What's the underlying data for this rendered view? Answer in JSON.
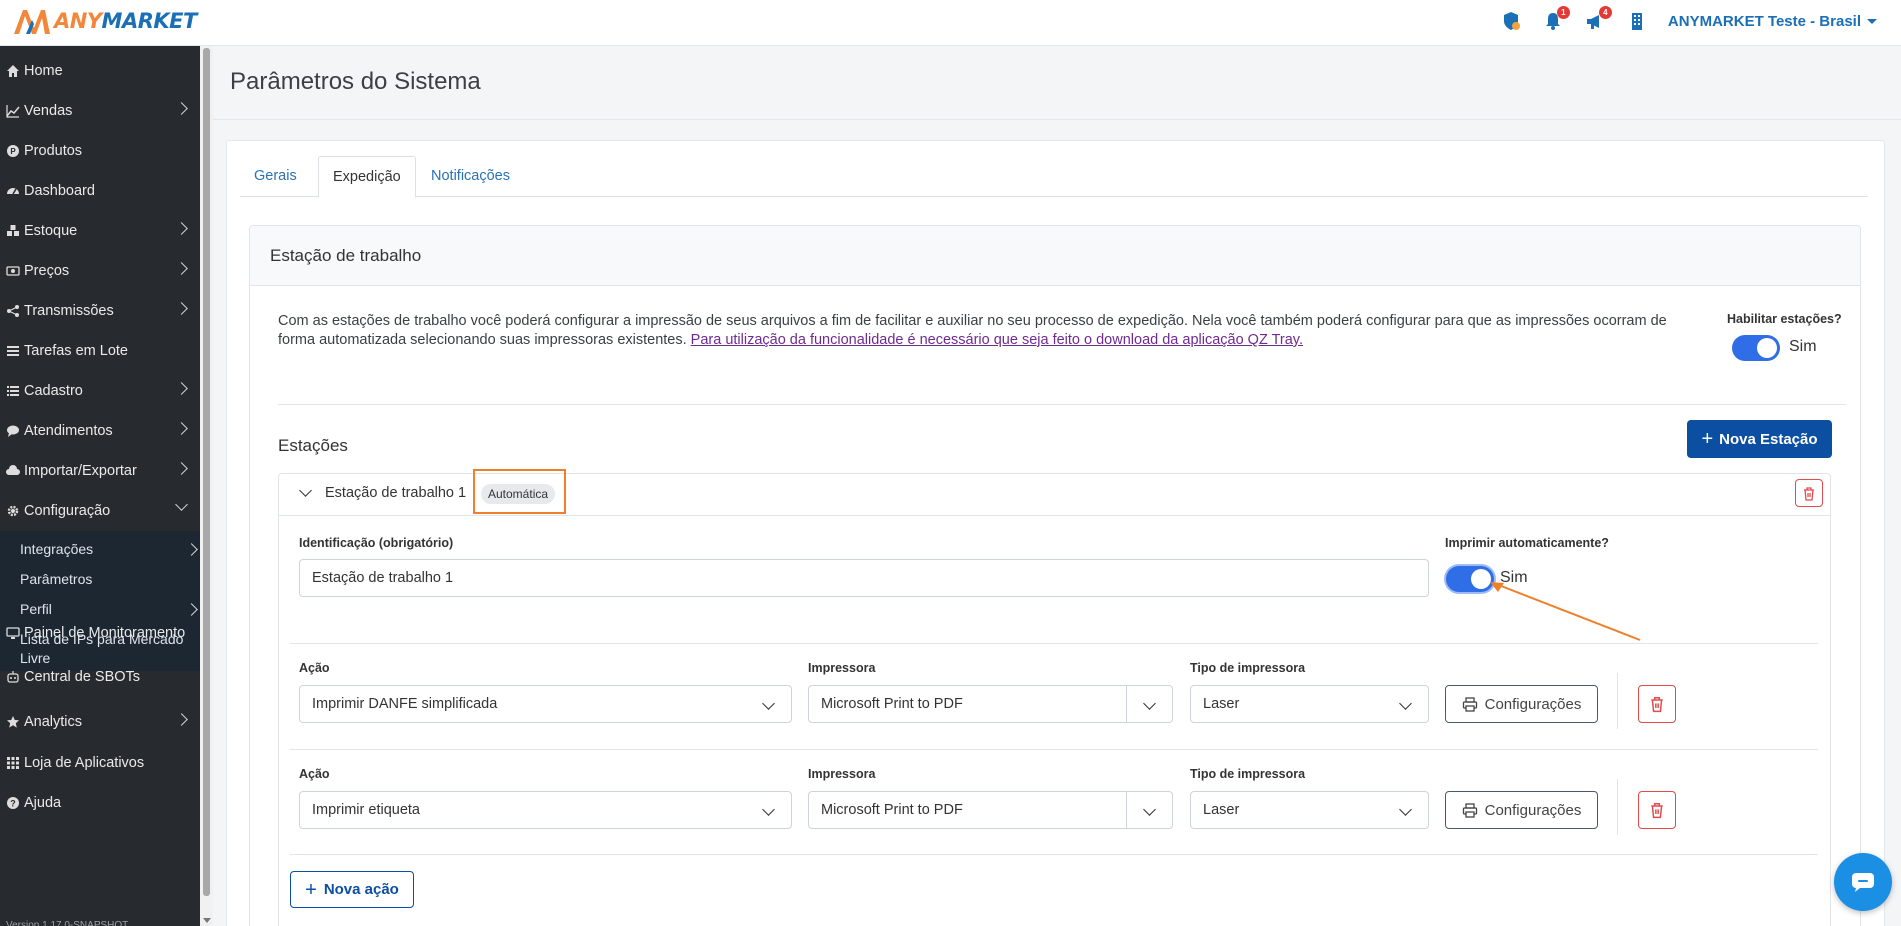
{
  "header": {
    "logo_text_part1": "ANY",
    "logo_text_part2": "MARKET",
    "notifications_count": "1",
    "announcements_count": "4",
    "account_name": "ANYMARKET Teste - Brasil"
  },
  "sidebar": {
    "items": [
      {
        "label": "Home",
        "icon": "home-icon",
        "has_children": false
      },
      {
        "label": "Vendas",
        "icon": "chart-line-icon",
        "has_children": true
      },
      {
        "label": "Produtos",
        "icon": "product-icon",
        "has_children": false
      },
      {
        "label": "Dashboard",
        "icon": "dashboard-icon",
        "has_children": false
      },
      {
        "label": "Estoque",
        "icon": "boxes-icon",
        "has_children": true
      },
      {
        "label": "Preços",
        "icon": "money-icon",
        "has_children": true
      },
      {
        "label": "Transmissões",
        "icon": "share-icon",
        "has_children": true
      },
      {
        "label": "Tarefas em Lote",
        "icon": "tasks-icon",
        "has_children": false
      },
      {
        "label": "Cadastro",
        "icon": "list-icon",
        "has_children": true
      },
      {
        "label": "Atendimentos",
        "icon": "chat-bubble-icon",
        "has_children": true
      },
      {
        "label": "Importar/Exportar",
        "icon": "cloud-icon",
        "has_children": true
      },
      {
        "label": "Configuração",
        "icon": "gear-icon",
        "has_children": true,
        "expanded": true
      }
    ],
    "sub_items": [
      {
        "label": "Integrações",
        "has_children": true
      },
      {
        "label": "Parâmetros",
        "has_children": false
      },
      {
        "label": "Perfil",
        "has_children": true
      },
      {
        "label": "Lista de IPs para Mercado Livre",
        "has_children": false
      }
    ],
    "items_after": [
      {
        "label": "Painel de Monitoramento",
        "icon": "monitor-icon",
        "has_children": false
      },
      {
        "label": "Central de SBOTs",
        "icon": "robot-icon",
        "has_children": false
      },
      {
        "label": "Analytics",
        "icon": "star-icon",
        "has_children": true
      },
      {
        "label": "Loja de Aplicativos",
        "icon": "grid-icon",
        "has_children": false
      },
      {
        "label": "Ajuda",
        "icon": "help-icon",
        "has_children": false
      }
    ],
    "version": "Version 1.17.0-SNAPSHOT"
  },
  "page": {
    "title": "Parâmetros do Sistema",
    "tabs": [
      {
        "label": "Gerais",
        "active": false
      },
      {
        "label": "Expedição",
        "active": true
      },
      {
        "label": "Notificações",
        "active": false
      }
    ]
  },
  "workstation": {
    "card_title": "Estação de trabalho",
    "description": "Com as estações de trabalho você poderá configurar a impressão de seus arquivos a fim de facilitar e auxiliar no seu processo de expedição. Nela você também poderá configurar para que as impressões ocorram de forma automatizada selecionando suas impressoras existentes. ",
    "description_link": "Para utilização da funcionalidade é necessário que seja feito o download da aplicação QZ Tray.",
    "enable_label": "Habilitar estações?",
    "enable_value": "Sim",
    "stations_title": "Estações",
    "new_station_button": "Nova Estação",
    "station": {
      "name": "Estação de trabalho 1",
      "badge": "Automática",
      "id_label": "Identificação (obrigatório)",
      "id_value": "Estação de trabalho 1",
      "auto_print_label": "Imprimir automaticamente?",
      "auto_print_value": "Sim",
      "actions": [
        {
          "action_label": "Ação",
          "action_value": "Imprimir DANFE simplificada",
          "printer_label": "Impressora",
          "printer_value": "Microsoft Print to PDF",
          "printer_type_label": "Tipo de impressora",
          "printer_type_value": "Laser",
          "config_button": "Configurações"
        },
        {
          "action_label": "Ação",
          "action_value": "Imprimir etiqueta",
          "printer_label": "Impressora",
          "printer_value": "Microsoft Print to PDF",
          "printer_type_label": "Tipo de impressora",
          "printer_type_value": "Laser",
          "config_button": "Configurações"
        }
      ],
      "new_action_button": "Nova ação"
    }
  },
  "colors": {
    "brand_blue": "#1b6fb6",
    "brand_orange": "#f2863b",
    "primary_button": "#0b4ea2",
    "toggle_on": "#2f6ee6",
    "danger": "#e24b4b",
    "highlight": "#f07f2a",
    "sidebar_bg": "#272b2f"
  }
}
